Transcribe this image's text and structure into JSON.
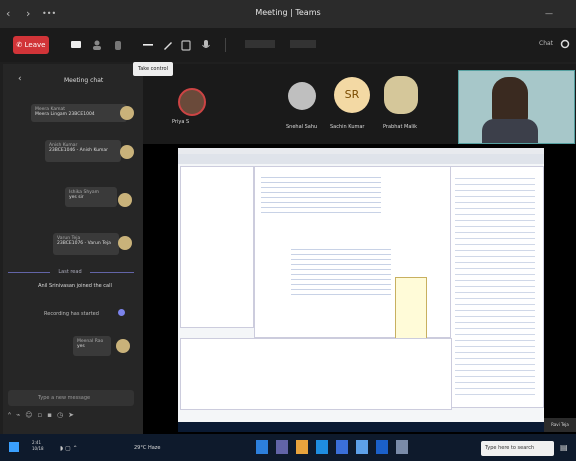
{
  "window": {
    "title": "Meeting | Teams"
  },
  "toolbar": {
    "leave_label": "Leave",
    "tooltip": "Take control",
    "right_label": "Chat"
  },
  "chat": {
    "title": "Meeting chat",
    "messages": [
      {
        "name": "Meera Kamat",
        "text": "Meera Lingam 23BCE1004"
      },
      {
        "name": "Anish Kumar",
        "text": "23BCE1046 - Anish Kumar"
      },
      {
        "name": "Ishika Shyam",
        "text": "yes sir"
      },
      {
        "name": "Varun Teja",
        "text": "23BCE1076 - Varun Teja"
      },
      {
        "name": "Meenal Rao",
        "text": "yes"
      }
    ],
    "divider_label": "Last read",
    "system_message": "Anil Srinivasan joined the call",
    "recording_text": "Recording has started",
    "compose_placeholder": "Type a new message"
  },
  "participants": [
    {
      "name": "Priya S"
    },
    {
      "name": "Snehal Sahu"
    },
    {
      "name": "Sachin Kumar",
      "initials": "SR"
    },
    {
      "name": "Prabhat Malik"
    }
  ],
  "presenter": {
    "name": "Ravi Teja"
  },
  "taskbar": {
    "weather": "29°C Haze",
    "search_placeholder": "Type here to search",
    "clock_time": "2:41",
    "clock_date": "10/18"
  },
  "colors": {
    "leave": "#d13438",
    "teams_dark": "#1f1f1f",
    "taskbar": "#0e1a2c"
  }
}
